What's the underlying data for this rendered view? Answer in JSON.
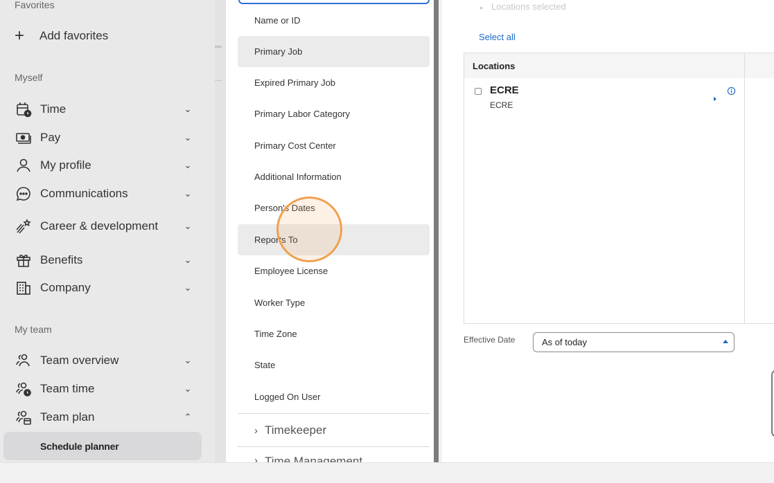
{
  "nav": {
    "favorites_heading": "Favorites",
    "add_favorites": "Add favorites",
    "myself_heading": "Myself",
    "myself_items": [
      {
        "label": "Time",
        "icon": "calendar-clock-icon",
        "chevron": "down"
      },
      {
        "label": "Pay",
        "icon": "money-icon",
        "chevron": "down"
      },
      {
        "label": "My profile",
        "icon": "person-icon",
        "chevron": "down"
      },
      {
        "label": "Communications",
        "icon": "chat-bubble-icon",
        "chevron": "down"
      },
      {
        "label": "Career & development",
        "icon": "shooting-star-icon",
        "chevron": "down"
      },
      {
        "label": "Benefits",
        "icon": "gift-icon",
        "chevron": "down"
      },
      {
        "label": "Company",
        "icon": "building-icon",
        "chevron": "down"
      }
    ],
    "myteam_heading": "My team",
    "myteam_items": [
      {
        "label": "Team overview",
        "icon": "team-icon",
        "chevron": "down"
      },
      {
        "label": "Team time",
        "icon": "team-clock-icon",
        "chevron": "down"
      },
      {
        "label": "Team plan",
        "icon": "team-calendar-icon",
        "chevron": "up"
      }
    ],
    "active_subitem": "Schedule planner"
  },
  "list": {
    "items": [
      "Name or ID",
      "Primary Job",
      "Expired Primary Job",
      "Primary Labor Category",
      "Primary Cost Center",
      "Additional Information",
      "Person's Dates",
      "Reports To",
      "Employee License",
      "Worker Type",
      "Time Zone",
      "State",
      "Logged On User"
    ],
    "groups": [
      "Timekeeper",
      "Time Management"
    ]
  },
  "locations": {
    "selected_text": "Locations selected",
    "select_all": "Select all",
    "header": "Locations",
    "rows": [
      {
        "name": "ECRE",
        "sub": "ECRE"
      }
    ]
  },
  "effective_date": {
    "label": "Effective Date",
    "value": "As of today"
  },
  "colors": {
    "accent": "#1b67c9",
    "click_ring": "#f0a050"
  }
}
